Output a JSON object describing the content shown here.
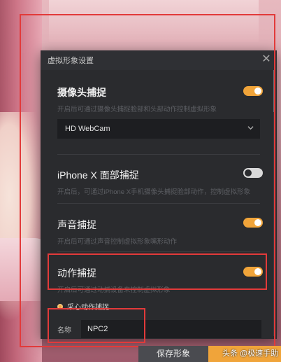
{
  "dialog": {
    "title": "虚拟形象设置"
  },
  "camera": {
    "title": "摄像头捕捉",
    "desc": "开启后可通过摄像头捕捉脸部和头部动作控制虚拟形象",
    "enabled": true,
    "device": "HD WebCam"
  },
  "iphone": {
    "title": "iPhone X 面部捕捉",
    "desc": "开启后，可通过iPhone X手机摄像头捕捉脸部动作，控制虚拟形象",
    "enabled": false
  },
  "voice": {
    "title": "声音捕捉",
    "desc": "开启后可通过声音控制虚拟形象嘴形动作",
    "enabled": true
  },
  "motion": {
    "title": "动作捕捉",
    "desc": "开启后可通过动捕设备来控制虚拟形象",
    "enabled": true,
    "option_label": "采心动作捕捉"
  },
  "name_field": {
    "label": "名称",
    "value": "NPC2"
  },
  "bottom": {
    "save_label": "保存形象",
    "watermark": "头条 @极速手助"
  },
  "colors": {
    "accent": "#f0a43a",
    "highlight_frame": "#e23a3a",
    "dialog_bg": "#2a2b2e"
  }
}
